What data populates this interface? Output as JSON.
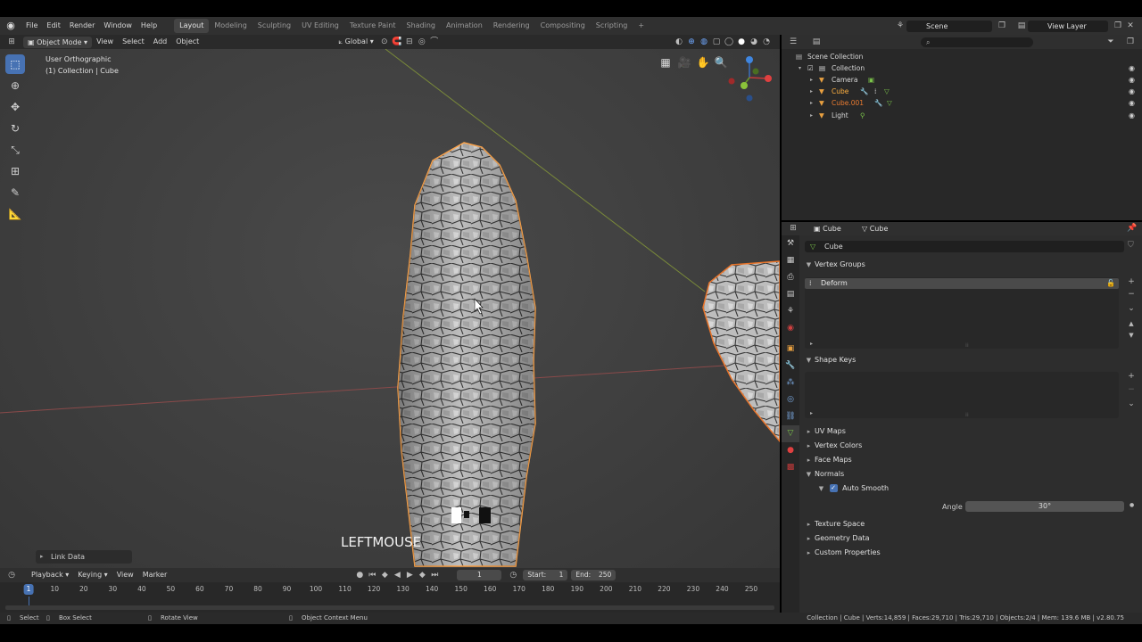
{
  "menu": {
    "items": [
      "File",
      "Edit",
      "Render",
      "Window",
      "Help"
    ],
    "workspaces": [
      "Layout",
      "Modeling",
      "Sculpting",
      "UV Editing",
      "Texture Paint",
      "Shading",
      "Animation",
      "Rendering",
      "Compositing",
      "Scripting"
    ],
    "active_workspace": "Layout",
    "add_tab": "+",
    "scene": "Scene",
    "view_layer": "View Layer"
  },
  "viewport": {
    "mode": "Object Mode",
    "menus": [
      "View",
      "Select",
      "Add",
      "Object"
    ],
    "orientation": "Global",
    "info_line1": "User Orthographic",
    "info_line2": "(1) Collection | Cube",
    "key_overlay": "LEFTMOUSE",
    "link_data": "Link Data"
  },
  "outliner": {
    "root": "Scene Collection",
    "rows": [
      {
        "label": "Collection",
        "icon": "collection-icon",
        "color": "#d8d8d8"
      },
      {
        "label": "Camera",
        "icon": "camera-icon",
        "color": "#d8d8d8"
      },
      {
        "label": "Cube",
        "icon": "mesh-icon",
        "color": "#e8a040"
      },
      {
        "label": "Cube.001",
        "icon": "mesh-icon",
        "color": "#e87a30"
      },
      {
        "label": "Light",
        "icon": "light-icon",
        "color": "#d8d8d8"
      }
    ]
  },
  "properties": {
    "breadcrumb_object": "Cube",
    "breadcrumb_data": "Cube",
    "data_name": "Cube",
    "panels": {
      "vertex_groups": "Vertex Groups",
      "vertex_group_item": "Deform",
      "shape_keys": "Shape Keys",
      "uv_maps": "UV Maps",
      "vertex_colors": "Vertex Colors",
      "face_maps": "Face Maps",
      "normals": "Normals",
      "auto_smooth": "Auto Smooth",
      "angle_label": "Angle",
      "angle_value": "30°",
      "texture_space": "Texture Space",
      "geometry_data": "Geometry Data",
      "custom_properties": "Custom Properties"
    }
  },
  "timeline": {
    "menus": [
      "Playback",
      "Keying",
      "View",
      "Marker"
    ],
    "current_frame": "1",
    "start_label": "Start:",
    "start": "1",
    "end_label": "End:",
    "end": "250",
    "ticks": [
      "1",
      "10",
      "20",
      "30",
      "40",
      "50",
      "60",
      "70",
      "80",
      "90",
      "100",
      "110",
      "120",
      "130",
      "140",
      "150",
      "160",
      "170",
      "180",
      "190",
      "200",
      "210",
      "220",
      "230",
      "240",
      "250"
    ]
  },
  "statusbar": {
    "select": "Select",
    "box_select": "Box Select",
    "rotate_view": "Rotate View",
    "context_menu": "Object Context Menu",
    "stats": "Collection | Cube | Verts:14,859 | Faces:29,710 | Tris:29,710 | Objects:2/4 | Mem: 139.6 MB | v2.80.75"
  },
  "colors": {
    "accent": "#4772b3",
    "selection_outline": "#e8742a",
    "active_outline": "#ffa64d",
    "header": "#303030",
    "panel": "#2d2d2d"
  }
}
